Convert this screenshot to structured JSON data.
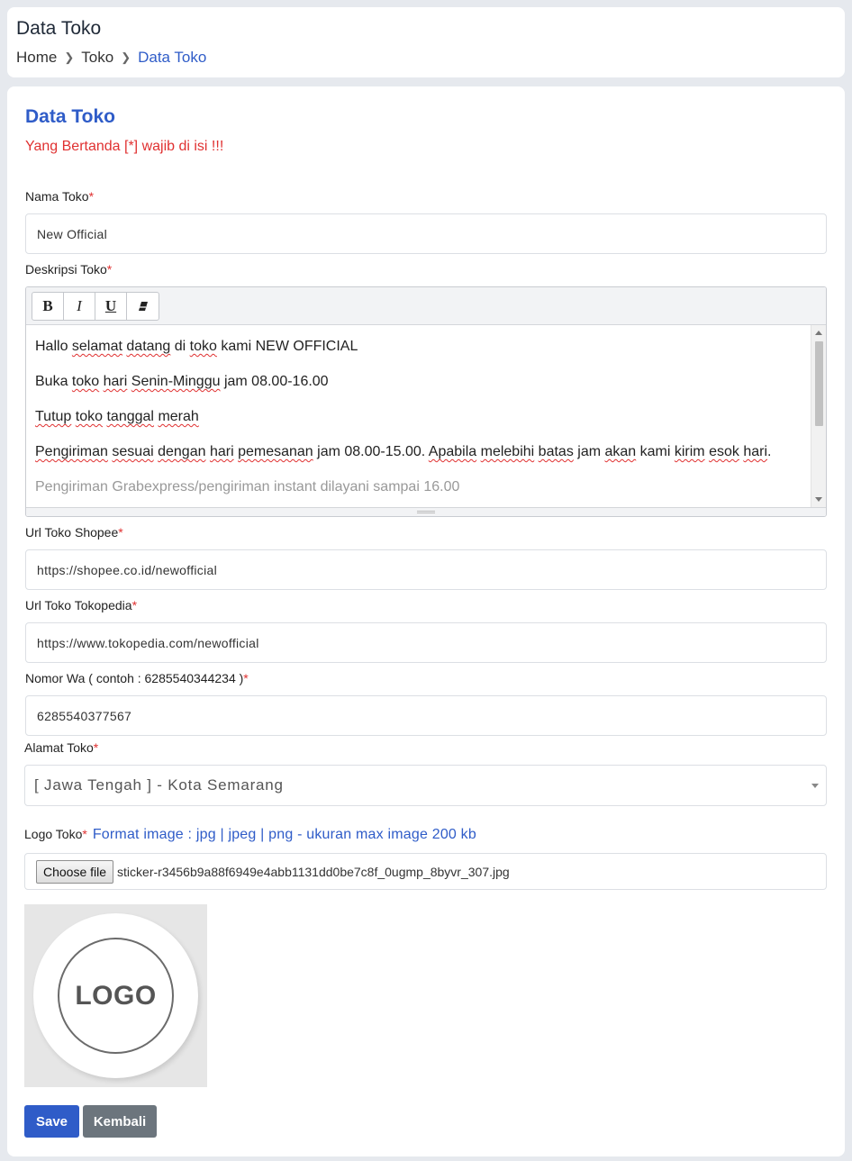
{
  "header": {
    "title": "Data Toko",
    "breadcrumb": [
      "Home",
      "Toko",
      "Data Toko"
    ]
  },
  "form": {
    "title": "Data Toko",
    "required_note": "Yang Bertanda [*] wajib di isi !!!",
    "required_marker": "*",
    "nama_toko": {
      "label": "Nama Toko",
      "value": "New Official"
    },
    "deskripsi": {
      "label": "Deskripsi Toko",
      "toolbar": [
        "bold",
        "italic",
        "underline",
        "eraser"
      ]
    },
    "url_shopee": {
      "label": "Url Toko Shopee",
      "value": "https://shopee.co.id/newofficial"
    },
    "url_tokopedia": {
      "label": "Url Toko Tokopedia",
      "value": "https://www.tokopedia.com/newofficial"
    },
    "nomor_wa": {
      "label": "Nomor Wa ( contoh : 6285540344234 )",
      "value": "6285540377567"
    },
    "alamat": {
      "label": "Alamat Toko",
      "value": "[ Jawa Tengah ] - Kota Semarang"
    },
    "logo": {
      "label": "Logo Toko",
      "hint": "Format image : jpg | jpeg | png - ukuran max image 200 kb",
      "file_button": "Choose file",
      "file_name": "sticker-r3456b9a88f6949e4abb1131dd0be7c8f_0ugmp_8byvr_307.jpg",
      "preview_text": "LOGO"
    },
    "buttons": {
      "save": "Save",
      "back": "Kembali"
    }
  },
  "colors": {
    "primary": "#2f5cc8",
    "danger": "#e03131",
    "secondary": "#6c757d"
  }
}
